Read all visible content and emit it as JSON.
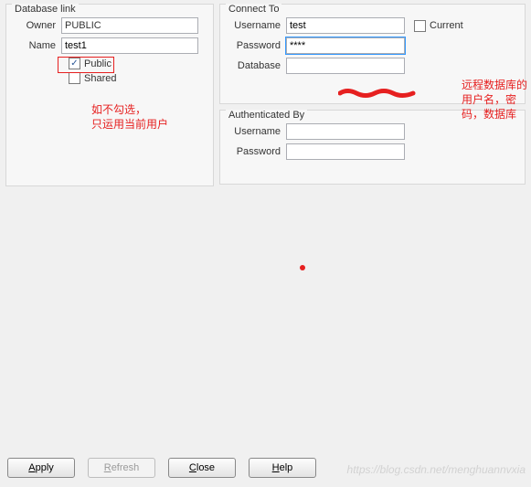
{
  "groups": {
    "dblink_title": "Database link",
    "connect_title": "Connect To",
    "auth_title": "Authenticated By"
  },
  "dblink": {
    "owner_label": "Owner",
    "owner_value": "PUBLIC",
    "name_label": "Name",
    "name_value": "test1",
    "public_label": "Public",
    "public_checked": true,
    "shared_label": "Shared",
    "shared_checked": false
  },
  "connect": {
    "username_label": "Username",
    "username_value": "test",
    "password_label": "Password",
    "password_value": "****",
    "database_label": "Database",
    "database_value": "",
    "current_label": "Current",
    "current_checked": false
  },
  "auth": {
    "username_label": "Username",
    "username_value": "",
    "password_label": "Password",
    "password_value": ""
  },
  "buttons": {
    "apply": "Apply",
    "refresh": "Refresh",
    "close": "Close",
    "help": "Help"
  },
  "annotations": {
    "note1_line1": "如不勾选，",
    "note1_line2": "只运用当前用户",
    "note2_line1": "远程数据库的",
    "note2_line2": "用户名，密",
    "note2_line3": "码，数据库"
  },
  "watermark": "https://blog.csdn.net/menghuannvxia",
  "check_glyph": "✓"
}
